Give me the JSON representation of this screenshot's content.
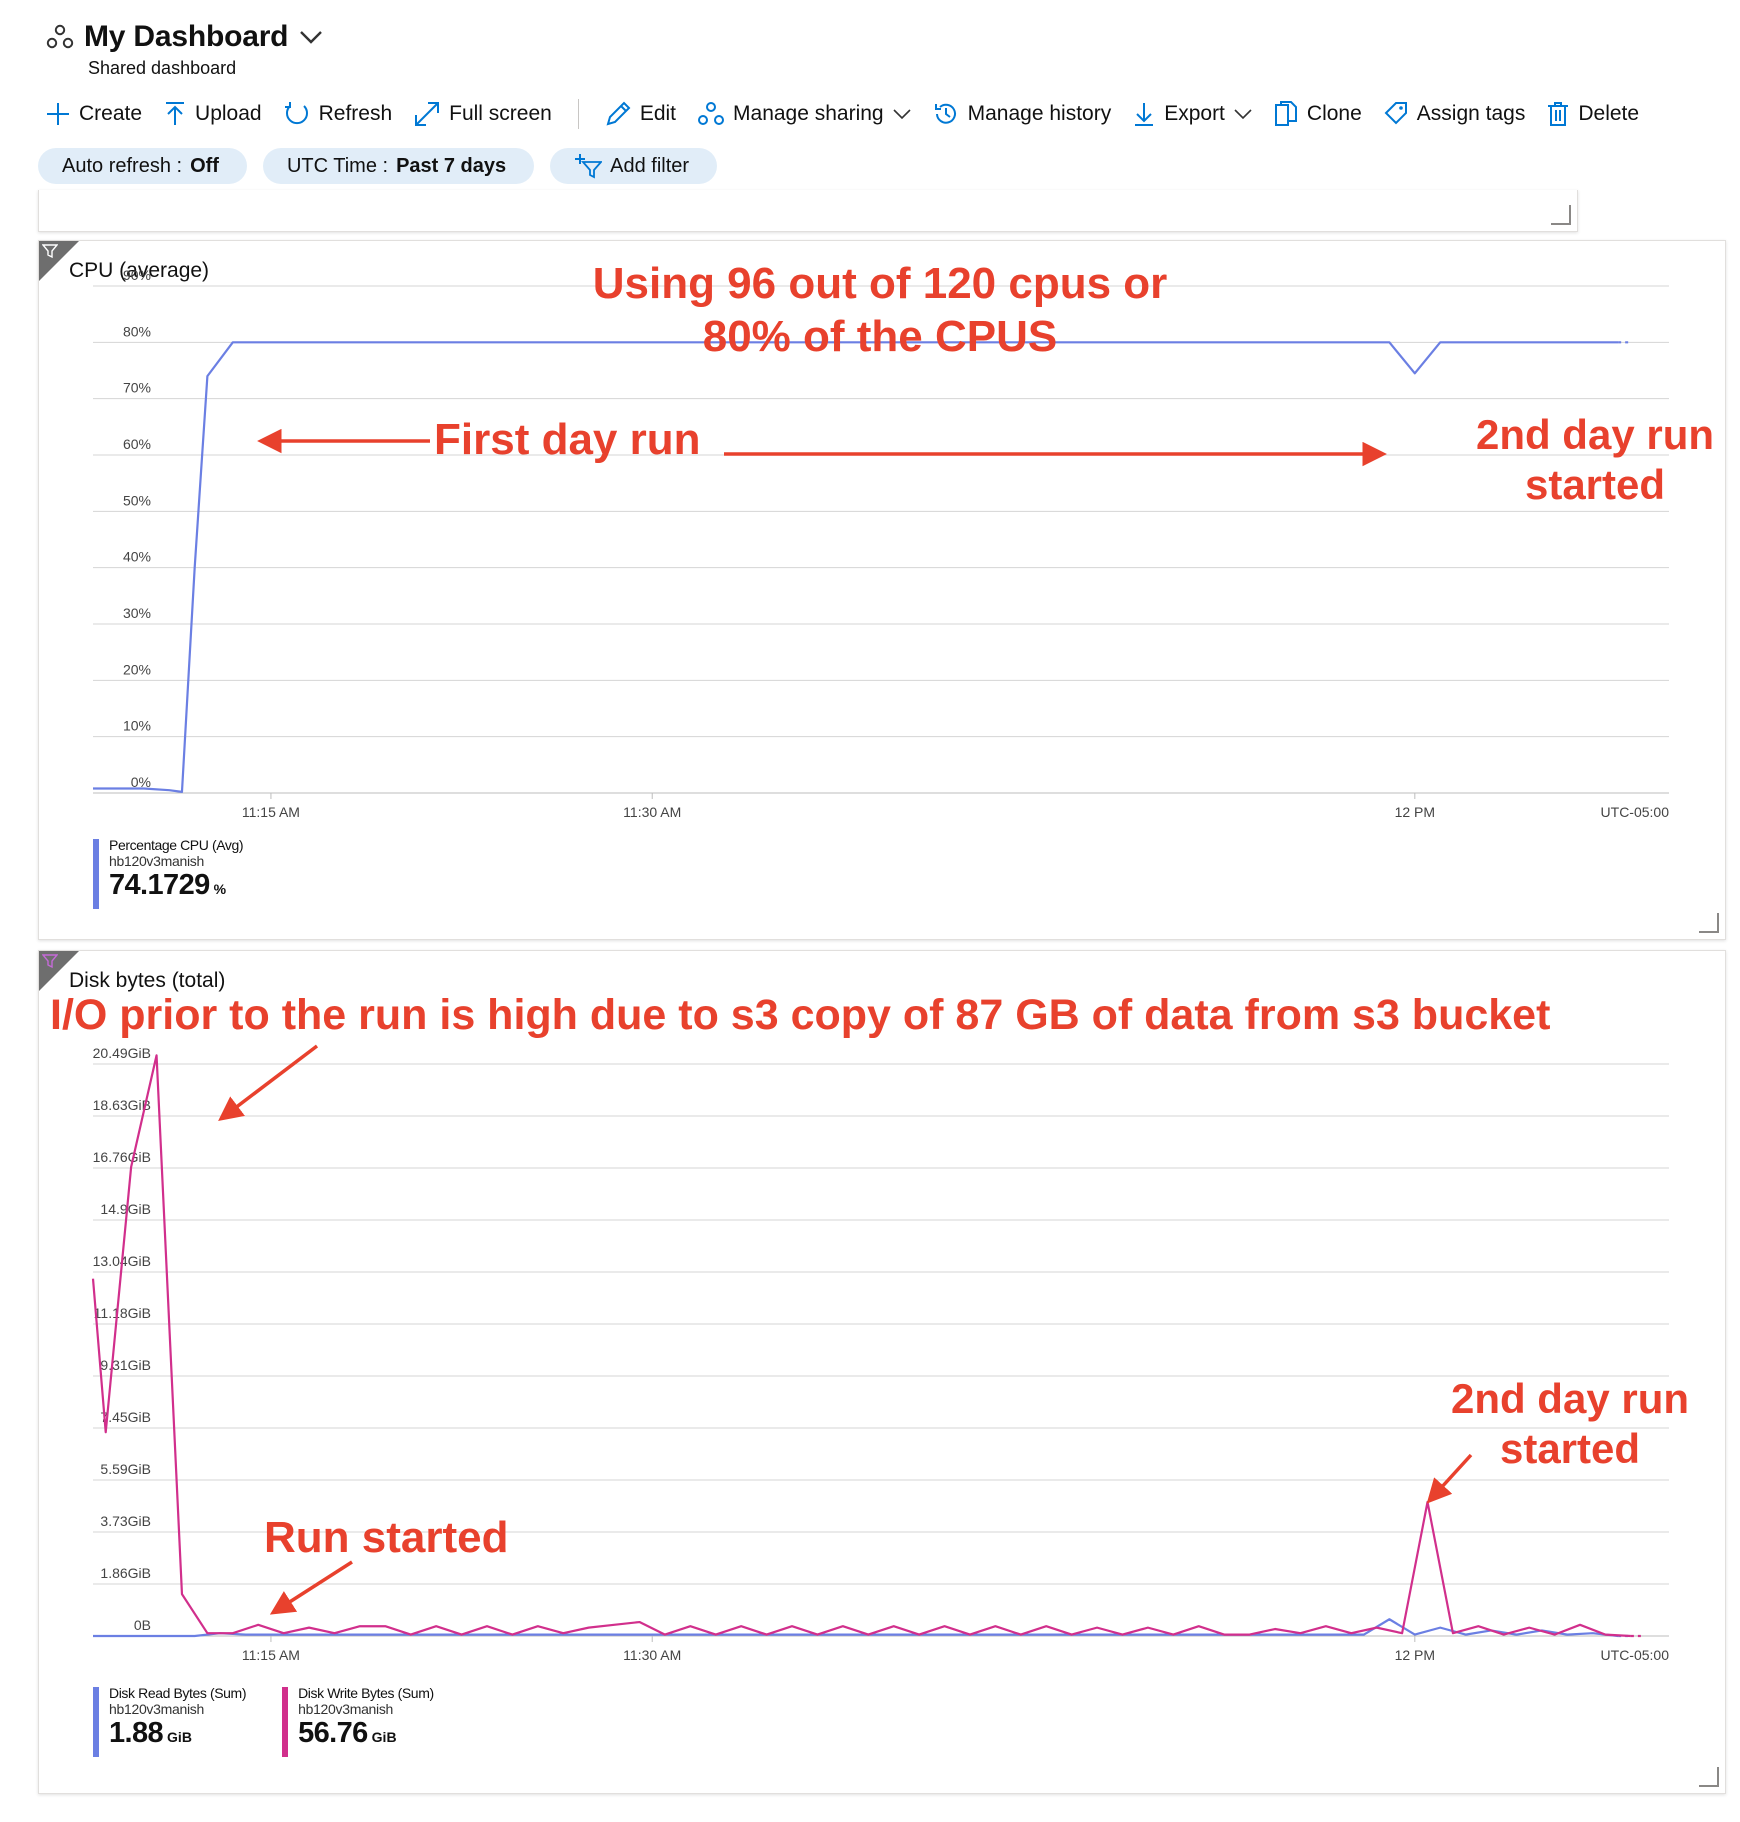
{
  "header": {
    "title": "My Dashboard",
    "subtitle": "Shared dashboard"
  },
  "toolbar": {
    "create": "Create",
    "upload": "Upload",
    "refresh": "Refresh",
    "fullscreen": "Full screen",
    "edit": "Edit",
    "manage_sharing": "Manage sharing",
    "manage_history": "Manage history",
    "export": "Export",
    "clone": "Clone",
    "assign_tags": "Assign tags",
    "delete": "Delete"
  },
  "filters": {
    "auto_refresh_label": "Auto refresh :",
    "auto_refresh_value": "Off",
    "time_label": "UTC Time :",
    "time_value": "Past 7 days",
    "add_filter": "Add filter"
  },
  "colors": {
    "accent": "#0078d4",
    "read_series": "#6b7fe3",
    "write_series": "#d12f8c",
    "annotation": "#e8412d",
    "pill_bg": "#e1edf8"
  },
  "cpu_tile": {
    "title": "CPU (average)",
    "legend": {
      "name": "Percentage CPU (Avg)",
      "resource": "hb120v3manish",
      "value": "74.1729",
      "unit": "%"
    }
  },
  "disk_tile": {
    "title": "Disk bytes (total)",
    "legend_read": {
      "name": "Disk Read Bytes (Sum)",
      "resource": "hb120v3manish",
      "value": "1.88",
      "unit": "GiB"
    },
    "legend_write": {
      "name": "Disk Write Bytes (Sum)",
      "resource": "hb120v3manish",
      "value": "56.76",
      "unit": "GiB"
    }
  },
  "annotations": {
    "cpu_usage_l1": "Using 96 out of 120 cpus or",
    "cpu_usage_l2": "80% of the CPUS",
    "first_day": "First day run",
    "second_day_l1": "2nd day run",
    "second_day_l2": "started",
    "io_prior": "I/O prior to the run is high due to s3 copy of 87 GB of data from s3 bucket",
    "run_started": "Run started",
    "second_day_disk_l1": "2nd day run",
    "second_day_disk_l2": "started"
  },
  "chart_data": [
    {
      "type": "line",
      "title": "CPU (average)",
      "y_ticks": [
        "0%",
        "10%",
        "20%",
        "30%",
        "40%",
        "50%",
        "60%",
        "70%",
        "80%",
        "90%"
      ],
      "x_ticks": [
        "11:15 AM",
        "11:30 AM",
        "12 PM"
      ],
      "timezone": "UTC-05:00",
      "ylim": [
        0,
        90
      ],
      "xlim_minutes": [
        0,
        62
      ],
      "x_tick_minutes": [
        7,
        22,
        52
      ],
      "series": [
        {
          "name": "Percentage CPU (Avg)",
          "color": "#6b7fe3",
          "x": [
            0,
            1,
            2,
            3,
            3.5,
            4,
            4.5,
            5.5,
            6,
            10,
            15,
            20,
            25,
            30,
            35,
            40,
            45,
            50,
            51,
            52,
            53,
            54,
            56,
            58,
            60
          ],
          "y": [
            0.8,
            0.8,
            0.8,
            0.5,
            0.2,
            40,
            74,
            80,
            80,
            80,
            80,
            80,
            80,
            80,
            80,
            80,
            80,
            80,
            80,
            74.5,
            80,
            80,
            80,
            80,
            80
          ]
        }
      ]
    },
    {
      "type": "line",
      "title": "Disk bytes (total)",
      "y_ticks": [
        "0B",
        "1.86GiB",
        "3.73GiB",
        "5.59GiB",
        "7.45GiB",
        "9.31GiB",
        "11.18GiB",
        "13.04GiB",
        "14.9GiB",
        "16.76GiB",
        "18.63GiB",
        "20.49GiB"
      ],
      "x_ticks": [
        "11:15 AM",
        "11:30 AM",
        "12 PM"
      ],
      "timezone": "UTC-05:00",
      "ylim": [
        0,
        20.49
      ],
      "xlim_minutes": [
        0,
        62
      ],
      "x_tick_minutes": [
        7,
        22,
        52
      ],
      "series": [
        {
          "name": "Disk Read Bytes (Sum)",
          "color": "#6b7fe3",
          "x": [
            0,
            1,
            2,
            3,
            4,
            5,
            6,
            7,
            8,
            9,
            10,
            11,
            12,
            13,
            14,
            15,
            16,
            17,
            18,
            19,
            20,
            21,
            22,
            23,
            24,
            25,
            26,
            27,
            28,
            29,
            30,
            31,
            32,
            33,
            34,
            35,
            36,
            37,
            38,
            39,
            40,
            41,
            42,
            43,
            44,
            45,
            46,
            47,
            48,
            49,
            50,
            51,
            52,
            53,
            54,
            55,
            56,
            57,
            58,
            59,
            60
          ],
          "y": [
            0,
            0,
            0,
            0,
            0,
            0.1,
            0.05,
            0.05,
            0.05,
            0.05,
            0.05,
            0.05,
            0.05,
            0.05,
            0.05,
            0.05,
            0.05,
            0.05,
            0.05,
            0.05,
            0.05,
            0.05,
            0.05,
            0.05,
            0.05,
            0.05,
            0.05,
            0.05,
            0.05,
            0.05,
            0.05,
            0.05,
            0.05,
            0.05,
            0.05,
            0.05,
            0.05,
            0.05,
            0.05,
            0.05,
            0.05,
            0.05,
            0.05,
            0.05,
            0.05,
            0.05,
            0.05,
            0.05,
            0.05,
            0.05,
            0.05,
            0.6,
            0.05,
            0.3,
            0.05,
            0.2,
            0.05,
            0.2,
            0.05,
            0.1,
            0
          ]
        },
        {
          "name": "Disk Write Bytes (Sum)",
          "color": "#d12f8c",
          "x": [
            0,
            0.5,
            1.5,
            2.5,
            3.5,
            4.5,
            5.5,
            6.5,
            7.5,
            8.5,
            9.5,
            10.5,
            11.5,
            12.5,
            13.5,
            14.5,
            15.5,
            16.5,
            17.5,
            18.5,
            19.5,
            20.5,
            21.5,
            22.5,
            23.5,
            24.5,
            25.5,
            26.5,
            27.5,
            28.5,
            29.5,
            30.5,
            31.5,
            32.5,
            33.5,
            34.5,
            35.5,
            36.5,
            37.5,
            38.5,
            39.5,
            40.5,
            41.5,
            42.5,
            43.5,
            44.5,
            45.5,
            46.5,
            47.5,
            48.5,
            49.5,
            50.5,
            51.5,
            52.5,
            53.5,
            54.5,
            55.5,
            56.5,
            57.5,
            58.5,
            59.5,
            60.5
          ],
          "y": [
            12.8,
            7.3,
            16.8,
            20.8,
            1.5,
            0.1,
            0.1,
            0.4,
            0.1,
            0.3,
            0.1,
            0.35,
            0.35,
            0.05,
            0.35,
            0.05,
            0.35,
            0.05,
            0.35,
            0.1,
            0.3,
            0.4,
            0.5,
            0.05,
            0.35,
            0.05,
            0.35,
            0.05,
            0.35,
            0.05,
            0.35,
            0.05,
            0.35,
            0.05,
            0.35,
            0.05,
            0.35,
            0.05,
            0.35,
            0.05,
            0.3,
            0.05,
            0.3,
            0.05,
            0.35,
            0.05,
            0.05,
            0.25,
            0.1,
            0.35,
            0.1,
            0.3,
            0.1,
            4.8,
            0.1,
            0.35,
            0.05,
            0.3,
            0.05,
            0.4,
            0.05,
            0
          ]
        }
      ]
    }
  ]
}
